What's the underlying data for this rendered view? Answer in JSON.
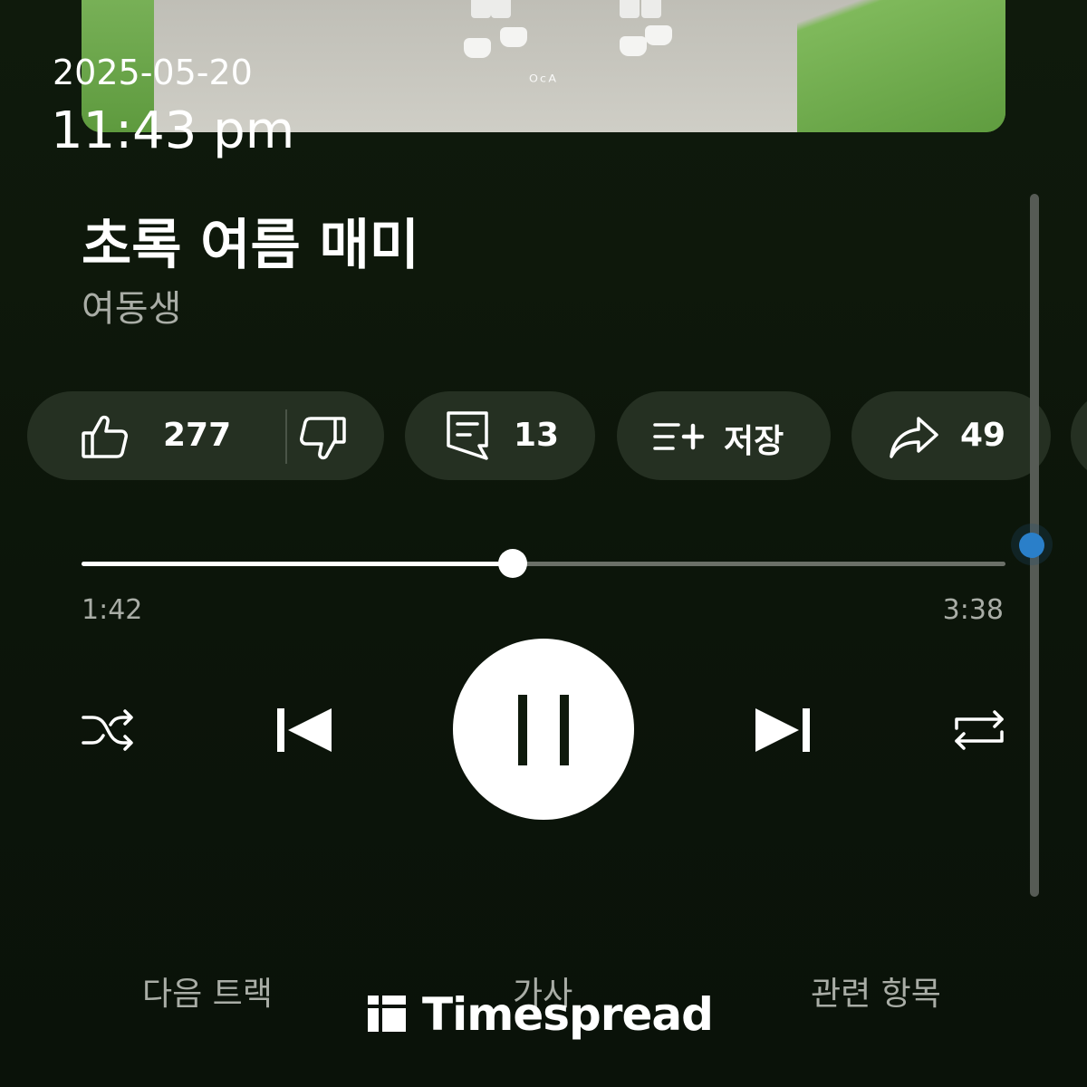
{
  "overlay": {
    "date": "2025-05-20",
    "time": "11:43 pm"
  },
  "album": {
    "mark": "ᴼᶜᴬ"
  },
  "song": {
    "title": "초록 여름 매미",
    "artist": "여동생"
  },
  "actions": {
    "like_count": "277",
    "comment_count": "13",
    "save_label": "저장",
    "share_count": "49",
    "icons": [
      "thumbs-up-icon",
      "thumbs-down-icon",
      "comment-icon",
      "playlist-add-icon",
      "share-icon"
    ]
  },
  "playback": {
    "current_time": "1:42",
    "total_time": "3:38",
    "progress_fraction": 0.467,
    "state": "playing"
  },
  "tabs": {
    "next": "다음 트랙",
    "lyrics": "가사",
    "related": "관련 항목"
  },
  "watermark": {
    "text": "Timespread"
  },
  "colors": {
    "background": "#0c150a",
    "chip": "#253022",
    "secondary_text": "#a9ada6",
    "scroll_indicator": "#2a7fc9"
  }
}
